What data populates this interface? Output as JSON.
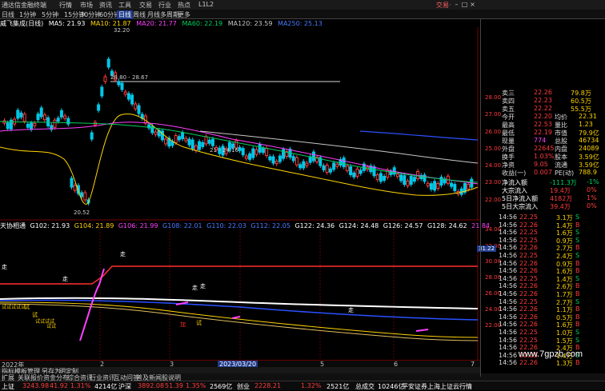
{
  "titlebar": {
    "app": "通达信金融终端",
    "menus": [
      "行情",
      "市场",
      "资讯",
      "工具",
      "交易",
      "行业",
      "热点",
      "L1L2"
    ],
    "brand": "交易·"
  },
  "toolbar": {
    "items": [
      "日线",
      "1分钟",
      "5分钟",
      "15分钟",
      "30分钟",
      "60分钟",
      "日线",
      "周线",
      "月线",
      "多周期",
      "更多"
    ],
    "active_index": 6
  },
  "ma": {
    "stock": "威飞集成(日线)",
    "items": [
      {
        "label": "MA5: 21.93",
        "color": "#ffffff"
      },
      {
        "label": "MA10: 21.87",
        "color": "#ffd400"
      },
      {
        "label": "MA20: 21.77",
        "color": "#ff40ff"
      },
      {
        "label": "MA60: 22.19",
        "color": "#00d060"
      },
      {
        "label": "MA120: 23.59",
        "color": "#c8c8c8"
      },
      {
        "label": "MA250: 25.13",
        "color": "#4a7bff"
      }
    ]
  },
  "main_chart": {
    "price_labels": [
      "28.00",
      "27.00",
      "26.00",
      "25.00",
      "24.00",
      "23.00",
      "22.00"
    ],
    "annotations": [
      "32.20",
      "28.80 - 28.67",
      "21 - 24.16",
      "20.52"
    ],
    "marker_lines": [
      "·22.01"
    ]
  },
  "sub_chart": {
    "name": "天协相通",
    "items": [
      "G102: 21.93",
      "G104: 21.89",
      "G106: 21.99",
      "G108: 22.01",
      "G110: 22.03",
      "G112: 22.05",
      "G122: 24.36",
      "G124: 24.48",
      "G126: 24.57",
      "G128: 24.62",
      "21.84"
    ],
    "price_labels": [
      "34.00",
      "32.00",
      "30.00",
      "28.00",
      "26.00",
      "24.00",
      "22.00"
    ],
    "price_tag": "31.22",
    "marks": [
      "走",
      "走",
      "走",
      "走",
      "走",
      "走",
      "加",
      "试",
      "试",
      "试"
    ]
  },
  "xaxis": {
    "labels": [
      "2022年",
      "2",
      "3",
      "4",
      "2023/03/20",
      "5",
      "6",
      "7"
    ]
  },
  "bottom_tabs": [
    "指标",
    "模板",
    "管理",
    "另存为",
    "明定制"
  ],
  "tabs2": [
    "扩展",
    "关联报价",
    "资金分布",
    "综合资讯",
    "行业资讯",
    "互动问答",
    "普及新闻股说明"
  ],
  "quote": {
    "rows": [
      {
        "label": "卖三",
        "price": "22.26",
        "vol": "79.8万"
      },
      {
        "label": "卖四",
        "price": "22.23",
        "vol": "60.5万"
      },
      {
        "label": "卖五",
        "price": "22.22",
        "vol": "55.5万"
      },
      {
        "label": "今开",
        "price": "22.20",
        "k": "均价",
        "v": "22.31"
      },
      {
        "label": "最高",
        "price": "22.53",
        "k": "量比",
        "v": "1.23"
      },
      {
        "label": "最低",
        "price": "22.19",
        "k": "市值",
        "v": "79.9亿"
      },
      {
        "label": "现量",
        "price": "774",
        "k": "总股",
        "v": "46734"
      },
      {
        "label": "外盘",
        "price": "22645",
        "k": "内盘",
        "v": "24089"
      },
      {
        "label": "换手",
        "price": "1.03%",
        "k": "股本",
        "v": "3.59亿"
      },
      {
        "label": "净资",
        "price": "9.05",
        "k": "流通",
        "v": "3.59亿"
      },
      {
        "label": "收益(一)",
        "price": "0.007",
        "k": "PE(动)",
        "v": "788.9"
      }
    ],
    "flows": [
      {
        "label": "净流入额",
        "v1": "-111.3万",
        "v2": "-1%"
      },
      {
        "label": "大宗流入",
        "v1": "19.4万",
        "v2": "0%"
      },
      {
        "label": "5日净流入额",
        "v1": "4182万",
        "v2": "1%"
      },
      {
        "label": "5日大宗流入",
        "v1": "39.4万",
        "v2": "0%"
      }
    ],
    "ticks": [
      {
        "t": "14:56",
        "p": "22.25",
        "v": "3.1万",
        "d": "S"
      },
      {
        "t": "14:56",
        "p": "22.26",
        "v": "1.4万",
        "d": "B"
      },
      {
        "t": "14:56",
        "p": "22.25",
        "v": "1.6万",
        "d": "S"
      },
      {
        "t": "14:56",
        "p": "22.25",
        "v": "0.9万",
        "d": "S"
      },
      {
        "t": "14:56",
        "p": "22.26",
        "v": "2.7万",
        "d": "B"
      },
      {
        "t": "14:56",
        "p": "22.25",
        "v": "2.4万",
        "d": "S"
      },
      {
        "t": "14:56",
        "p": "22.26",
        "v": "0.9万",
        "d": "B"
      },
      {
        "t": "14:56",
        "p": "22.26",
        "v": "1.6万",
        "d": "B"
      },
      {
        "t": "14:56",
        "p": "22.25",
        "v": "1.4万",
        "d": "S"
      },
      {
        "t": "14:56",
        "p": "22.26",
        "v": "2.6万",
        "d": "B"
      },
      {
        "t": "14:56",
        "p": "22.26",
        "v": "1.7万",
        "d": "B"
      },
      {
        "t": "14:56",
        "p": "22.25",
        "v": "2.7万",
        "d": "S"
      },
      {
        "t": "14:56",
        "p": "22.26",
        "v": "1.1万",
        "d": "B"
      },
      {
        "t": "14:56",
        "p": "22.26",
        "v": "0.5万",
        "d": "B"
      },
      {
        "t": "14:56",
        "p": "22.26",
        "v": "1.6万",
        "d": "B"
      },
      {
        "t": "14:56",
        "p": "22.25",
        "v": "1.0万",
        "d": "S"
      },
      {
        "t": "14:56",
        "p": "22.25",
        "v": "1.5万",
        "d": "S"
      },
      {
        "t": "14:56",
        "p": "22.26",
        "v": "2.4万",
        "d": "B"
      },
      {
        "t": "14:56",
        "p": "22.25",
        "v": "1.4万",
        "d": "S"
      },
      {
        "t": "14:56",
        "p": "22.26",
        "v": "1.3万",
        "d": "B"
      }
    ]
  },
  "status": {
    "items": [
      {
        "k": "上证",
        "v": "3243.98",
        "c": "41.92",
        "p": "1.31%",
        "a": "4214亿"
      },
      {
        "k": "沪深",
        "v": "3892.08",
        "c": "51.39",
        "p": "1.35%",
        "a": "2569亿"
      },
      {
        "k": "创业",
        "v": "2228.21",
        "c": "",
        "p": "1.32%",
        "a": "2521亿"
      }
    ],
    "extra": "总成交",
    "extra_v": "10246亿",
    "news": "平安证券上海上证云行情"
  },
  "watermark": "www.7gpzb.com",
  "colors": {
    "up": "#ff3b3b",
    "down": "#00d0e8",
    "bg": "#000000"
  }
}
